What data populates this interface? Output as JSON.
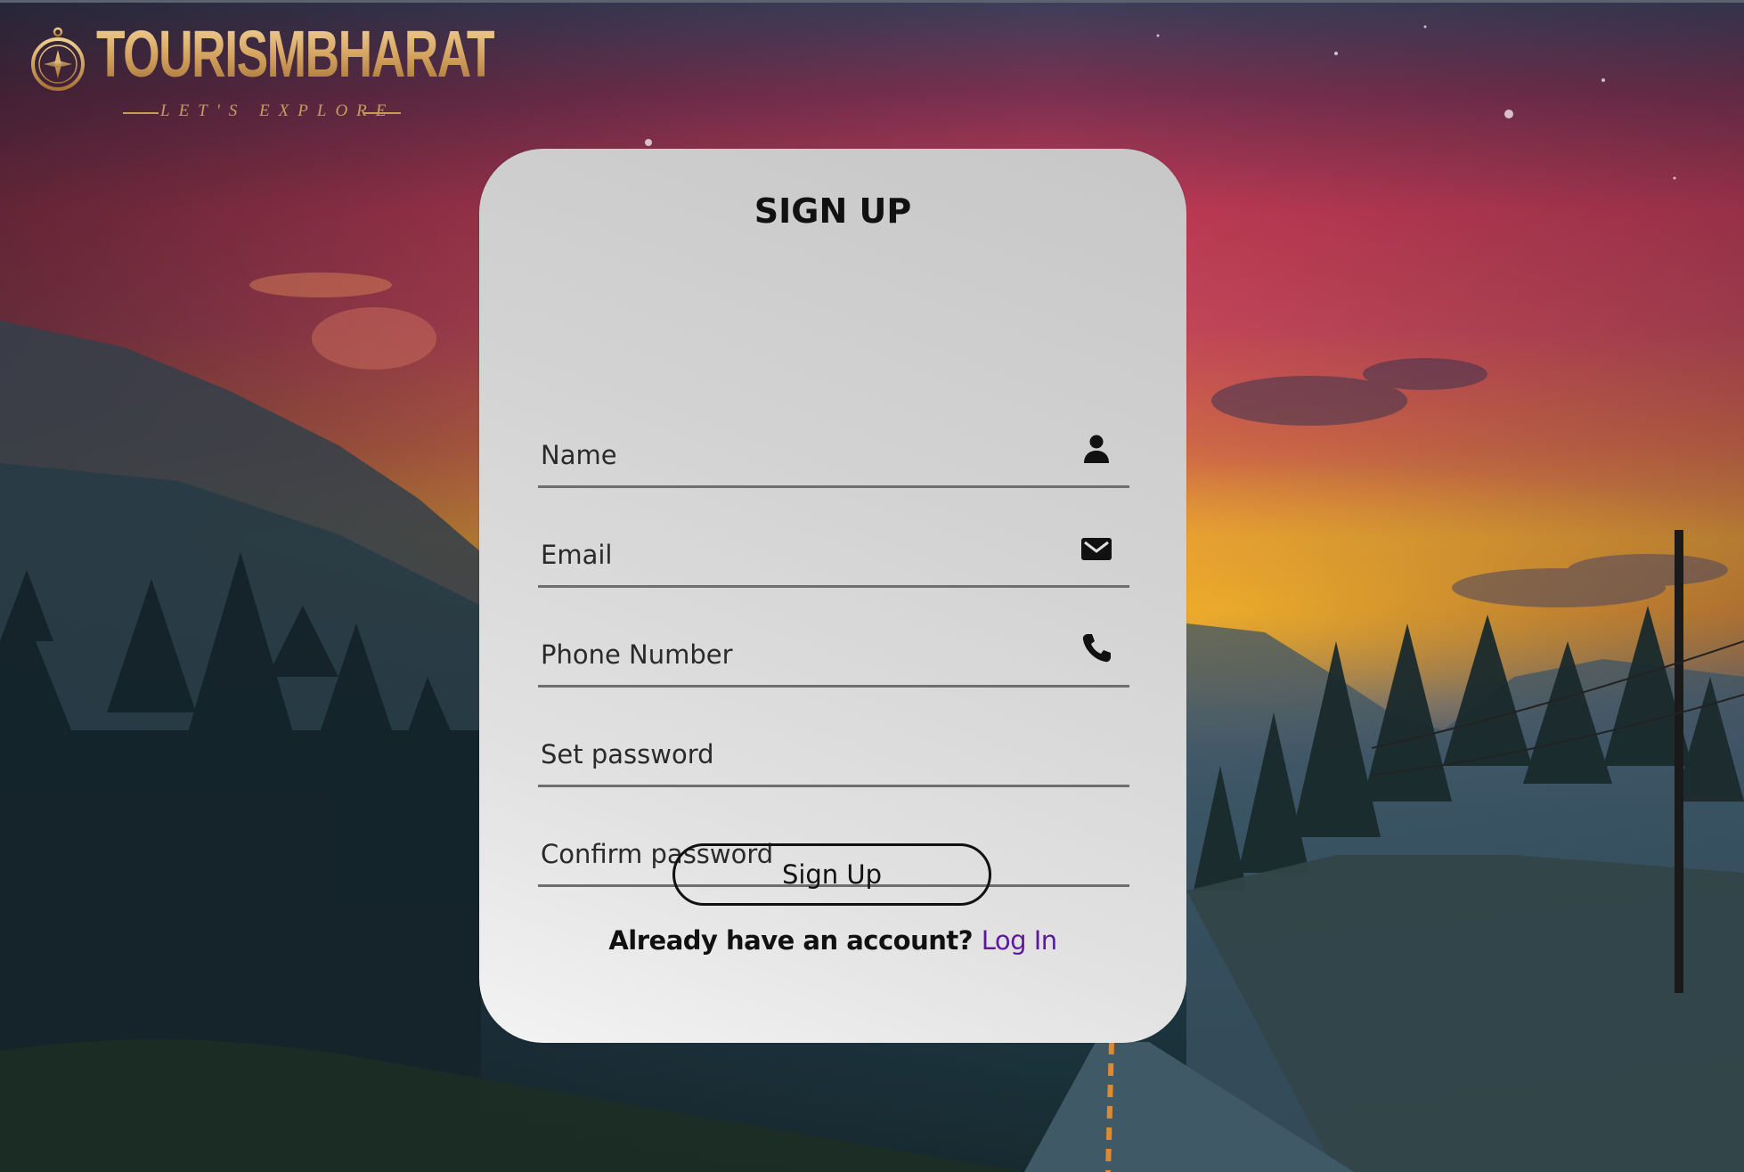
{
  "brand": {
    "name": "TOURISMBHARAT",
    "tagline": "LET'S EXPLORE",
    "logo_icon": "compass-icon"
  },
  "form": {
    "title": "SIGN UP",
    "fields": [
      {
        "placeholder": "Name",
        "icon": "user-icon"
      },
      {
        "placeholder": "Email",
        "icon": "envelope-icon"
      },
      {
        "placeholder": "Phone Number",
        "icon": "phone-icon"
      },
      {
        "placeholder": "Set password"
      },
      {
        "placeholder": "Confirm password"
      }
    ],
    "submit_label": "Sign Up",
    "login_prompt": "Already have an account?",
    "login_link": "Log In"
  },
  "colors": {
    "brand_gold": "#d2a05c",
    "link_purple": "#5b1a9a",
    "card_background": "#d3d3d3"
  }
}
